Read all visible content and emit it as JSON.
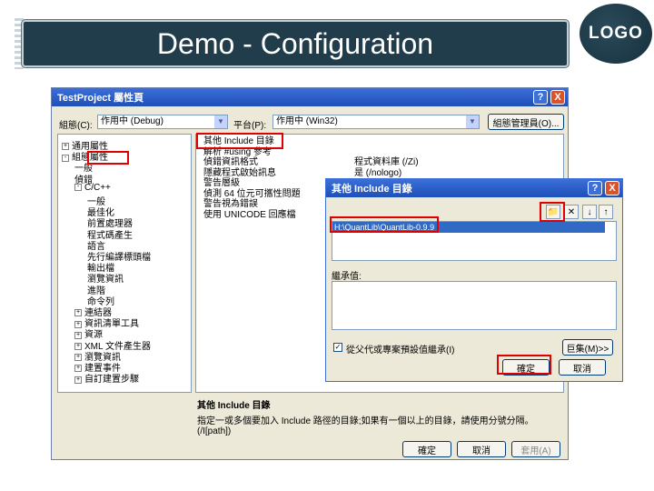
{
  "slide": {
    "title": "Demo - Configuration",
    "logo_text": "LOGO"
  },
  "main_window": {
    "title": "TestProject 屬性頁",
    "help_btn": "?",
    "close_btn": "X",
    "config_label": "組態(C):",
    "config_value": "作用中 (Debug)",
    "platform_label": "平台(P):",
    "platform_value": "作用中 (Win32)",
    "config_manager_button": "組態管理員(O)...",
    "tree": [
      {
        "label": "通用屬性",
        "depth": 0,
        "expander": "+"
      },
      {
        "label": "組態屬性",
        "depth": 0,
        "expander": "-"
      },
      {
        "label": "一般",
        "depth": 1,
        "expander": ""
      },
      {
        "label": "偵錯",
        "depth": 1,
        "expander": ""
      },
      {
        "label": "C/C++",
        "depth": 1,
        "expander": "-"
      },
      {
        "label": "一般",
        "depth": 2,
        "expander": ""
      },
      {
        "label": "最佳化",
        "depth": 2,
        "expander": ""
      },
      {
        "label": "前置處理器",
        "depth": 2,
        "expander": ""
      },
      {
        "label": "程式碼產生",
        "depth": 2,
        "expander": ""
      },
      {
        "label": "語言",
        "depth": 2,
        "expander": ""
      },
      {
        "label": "先行編譯標頭檔",
        "depth": 2,
        "expander": ""
      },
      {
        "label": "輸出檔",
        "depth": 2,
        "expander": ""
      },
      {
        "label": "瀏覽資訊",
        "depth": 2,
        "expander": ""
      },
      {
        "label": "進階",
        "depth": 2,
        "expander": ""
      },
      {
        "label": "命令列",
        "depth": 2,
        "expander": ""
      },
      {
        "label": "連結器",
        "depth": 1,
        "expander": "+"
      },
      {
        "label": "資訊清單工具",
        "depth": 1,
        "expander": "+"
      },
      {
        "label": "資源",
        "depth": 1,
        "expander": "+"
      },
      {
        "label": "XML 文件產生器",
        "depth": 1,
        "expander": "+"
      },
      {
        "label": "瀏覽資訊",
        "depth": 1,
        "expander": "+"
      },
      {
        "label": "建置事件",
        "depth": 1,
        "expander": "+"
      },
      {
        "label": "自訂建置步驟",
        "depth": 1,
        "expander": "+"
      }
    ],
    "properties": [
      {
        "name": "其他 Include 目錄",
        "value": ""
      },
      {
        "name": "解析 #using 參考",
        "value": ""
      },
      {
        "name": "偵錯資訊格式",
        "value": "程式資料庫 (/Zi)"
      },
      {
        "name": "隱藏程式啟始訊息",
        "value": "是 (/nologo)"
      },
      {
        "name": "警告層級",
        "value": ""
      },
      {
        "name": "偵測 64 位元可攜性問題",
        "value": ""
      },
      {
        "name": "警告視為錯誤",
        "value": ""
      },
      {
        "name": "使用 UNICODE 回應檔",
        "value": ""
      }
    ],
    "desc_title": "其他 Include 目錄",
    "desc_text": "指定一或多個要加入 Include 路徑的目錄;如果有一個以上的目錄，請使用分號分隔。     (/I[path])",
    "ok_button": "確定",
    "cancel_button": "取消",
    "apply_button": "套用(A)"
  },
  "include_dialog": {
    "title": "其他 Include 目錄",
    "help_btn": "?",
    "close_btn": "X",
    "tool_icons": [
      "new-folder-icon",
      "delete-icon",
      "move-down-icon",
      "move-up-icon"
    ],
    "path_value": "H:\\QuantLib\\QuantLib-0.9.9",
    "inherited_label": "繼承值:",
    "inherit_checkbox_label": "從父代或專案預設值繼承(I)",
    "macros_button": "巨集(M)>>",
    "ok_button": "確定",
    "cancel_button": "取消"
  },
  "colors": {
    "title_bg": "#213c4a",
    "highlight": "#e00000",
    "titlebar": "#1f4fb8"
  }
}
